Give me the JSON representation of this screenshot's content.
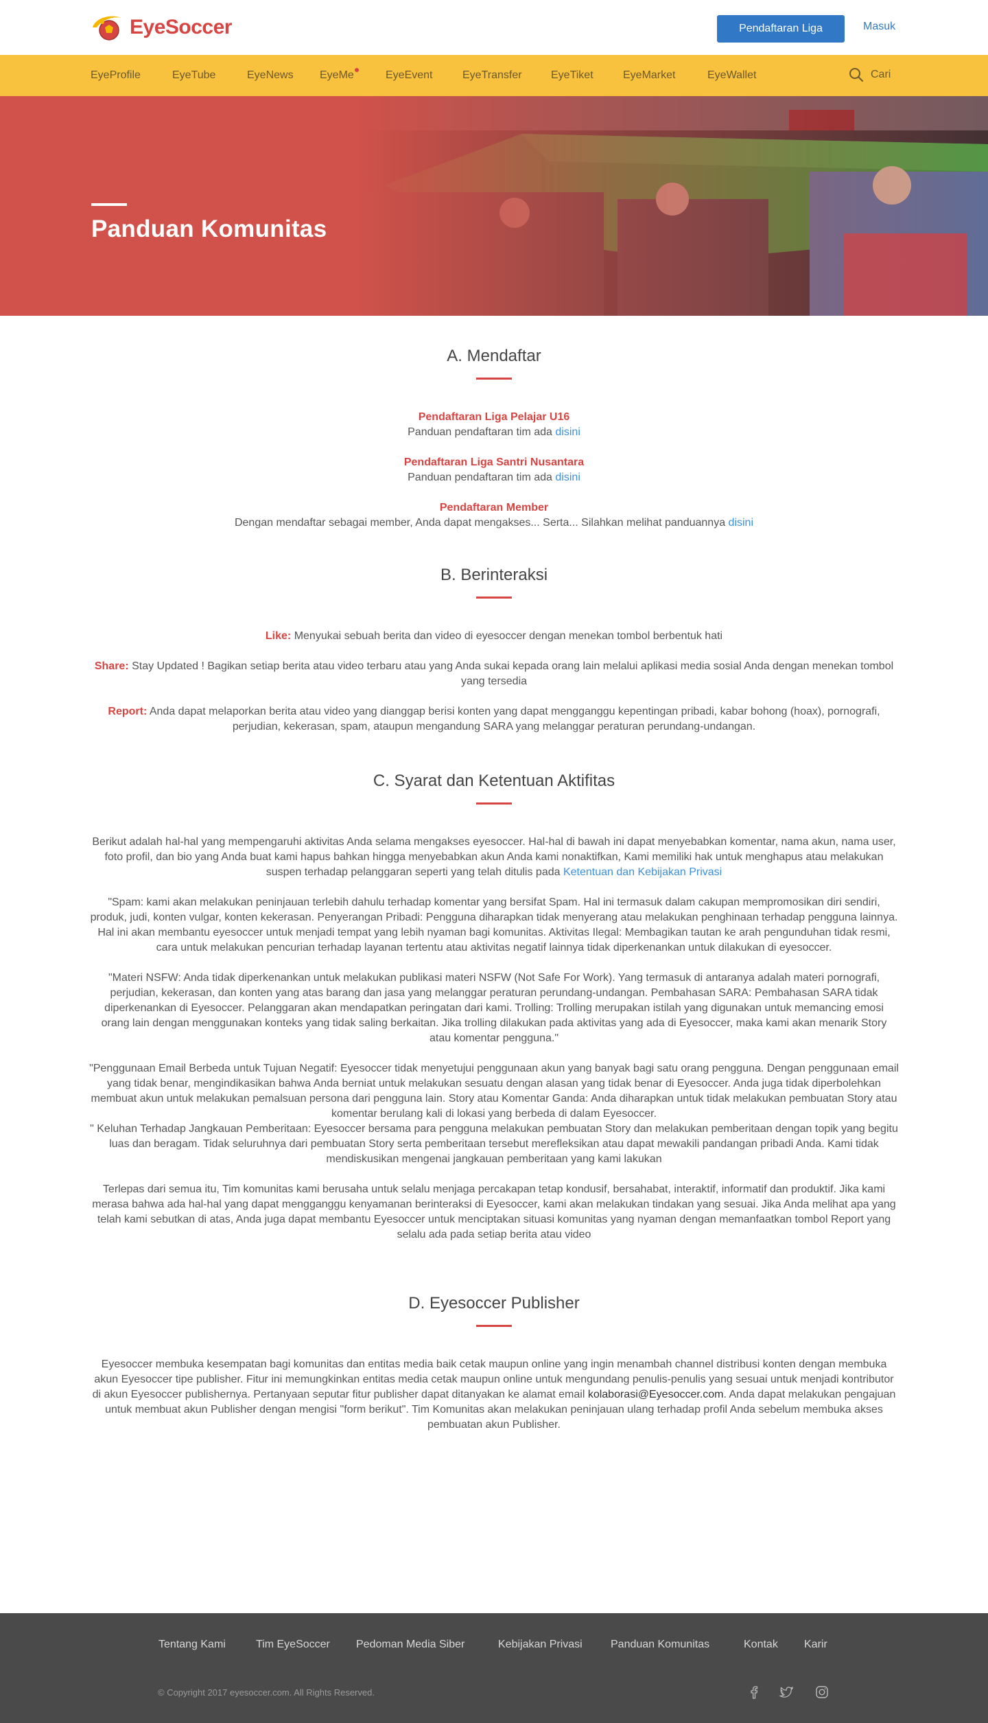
{
  "brand": {
    "name": "EyeSoccer",
    "logo_icon": "soccer-ball-logo-icon",
    "accent": "#d64541",
    "nav_color": "#f8c13e",
    "button_color": "#3179c6"
  },
  "header": {
    "register_label": "Pendaftaran Liga",
    "login_label": "Masuk"
  },
  "nav": {
    "items": [
      "EyeProfile",
      "EyeTube",
      "EyeNews",
      "EyeMe",
      "EyeEvent",
      "EyeTransfer",
      "EyeTiket",
      "EyeMarket",
      "EyeWallet"
    ],
    "search_label": "Cari",
    "search_icon": "search-icon"
  },
  "hero": {
    "title": "Panduan Komunitas"
  },
  "sec_a": {
    "title": "A. Mendaftar",
    "items": [
      {
        "heading": "Pendaftaran Liga Pelajar U16",
        "text": "Panduan pendaftaran tim ada",
        "link": "disini"
      },
      {
        "heading": "Pendaftaran Liga Santri Nusantara",
        "text": "Panduan pendaftaran tim ada",
        "link": "disini"
      },
      {
        "heading": "Pendaftaran Member",
        "text": "Dengan mendaftar sebagai member, Anda dapat mengakses... Serta... Silahkan melihat panduannya",
        "link": "disini"
      }
    ]
  },
  "sec_b": {
    "title": "B. Berinteraksi",
    "items": [
      {
        "label": "Like:",
        "text": "Menyukai sebuah berita dan video di eyesoccer dengan menekan tombol berbentuk hati"
      },
      {
        "label": "Share:",
        "text": "Stay Updated ! Bagikan setiap berita atau video terbaru atau yang Anda sukai kepada orang lain melalui aplikasi media sosial Anda dengan menekan tombol yang tersedia"
      },
      {
        "label": "Report:",
        "text": "Anda dapat melaporkan berita atau video yang dianggap berisi konten yang dapat mengganggu kepentingan pribadi, kabar bohong (hoax), pornografi, perjudian, kekerasan, spam, ataupun mengandung SARA yang melanggar peraturan perundang-undangan."
      }
    ]
  },
  "sec_c": {
    "title": "C. Syarat dan Ketentuan Aktifitas",
    "intro": "Berikut adalah hal-hal yang mempengaruhi aktivitas Anda selama mengakses eyesoccer. Hal-hal di bawah ini dapat menyebabkan komentar, nama akun, nama user, foto profil, dan bio yang Anda buat kami hapus bahkan hingga menyebabkan akun Anda kami nonaktifkan, Kami memiliki hak untuk menghapus atau melakukan suspen terhadap pelanggaran seperti yang telah ditulis pada",
    "intro_link": "Ketentuan dan Kebijakan Privasi",
    "p1": "\"Spam: kami akan melakukan peninjauan terlebih dahulu terhadap komentar yang bersifat Spam. Hal ini termasuk dalam cakupan mempromosikan diri sendiri, produk, judi, konten vulgar, konten kekerasan. Penyerangan Pribadi: Pengguna diharapkan tidak menyerang atau melakukan penghinaan terhadap pengguna lainnya. Hal ini akan membantu eyesoccer untuk menjadi tempat yang lebih nyaman bagi komunitas. Aktivitas Ilegal: Membagikan tautan ke arah pengunduhan tidak resmi, cara untuk melakukan pencurian terhadap layanan tertentu atau aktivitas negatif lainnya tidak diperkenankan untuk dilakukan di eyesoccer.",
    "p2": "\"Materi NSFW: Anda tidak diperkenankan untuk melakukan publikasi materi NSFW (Not Safe For Work). Yang termasuk di antaranya adalah materi pornografi, perjudian, kekerasan, dan konten yang atas barang dan jasa yang melanggar peraturan perundang-undangan. Pembahasan SARA: Pembahasan SARA tidak diperkenankan di Eyesoccer. Pelanggaran akan mendapatkan peringatan dari kami. Trolling: Trolling merupakan istilah yang digunakan untuk memancing emosi orang lain dengan menggunakan konteks yang tidak saling berkaitan. Jika trolling dilakukan pada aktivitas yang ada di Eyesoccer, maka kami akan menarik Story atau komentar pengguna.\"",
    "p3a": "\"Penggunaan Email Berbeda untuk Tujuan Negatif: Eyesoccer tidak menyetujui penggunaan akun yang banyak bagi satu orang pengguna. Dengan penggunaan email yang tidak benar, mengindikasikan bahwa Anda berniat untuk melakukan sesuatu dengan alasan yang tidak benar di Eyesoccer. Anda juga tidak diperbolehkan membuat akun untuk melakukan pemalsuan persona dari pengguna lain. Story atau Komentar Ganda: Anda diharapkan untuk tidak melakukan pembuatan Story atau komentar berulang kali di lokasi yang berbeda di dalam Eyesoccer.",
    "p3b": "\" Keluhan Terhadap Jangkauan Pemberitaan: Eyesoccer bersama para pengguna melakukan pembuatan Story dan melakukan pemberitaan dengan topik yang begitu luas dan beragam. Tidak seluruhnya dari pembuatan Story serta pemberitaan tersebut merefleksikan atau dapat mewakili pandangan pribadi Anda. Kami tidak mendiskusikan mengenai jangkauan pemberitaan yang kami lakukan",
    "p4": "Terlepas dari semua itu, Tim komunitas kami berusaha untuk selalu menjaga percakapan tetap kondusif, bersahabat, interaktif, informatif dan produktif. Jika kami merasa bahwa ada hal-hal yang dapat mengganggu kenyamanan berinteraksi di Eyesoccer, kami akan melakukan tindakan yang sesuai. Jika Anda melihat apa yang telah kami sebutkan di atas, Anda juga dapat membantu Eyesoccer untuk menciptakan situasi komunitas yang nyaman dengan memanfaatkan tombol Report yang selalu ada pada setiap berita atau video"
  },
  "sec_d": {
    "title": "D. Eyesoccer Publisher",
    "text_before": "Eyesoccer membuka kesempatan bagi komunitas dan entitas media baik cetak maupun online yang ingin menambah channel distribusi konten dengan membuka akun Eyesoccer tipe publisher. Fitur ini memungkinkan entitas media cetak maupun online untuk mengundang penulis-penulis yang sesuai untuk menjadi kontributor di akun Eyesoccer publishernya. Pertanyaan seputar fitur publisher dapat ditanyakan ke alamat email",
    "email": "kolaborasi@Eyesoccer.com",
    "text_after": ". Anda dapat melakukan pengajuan untuk membuat akun Publisher dengan mengisi \"form berikut\". Tim Komunitas akan melakukan peninjauan ulang terhadap profil Anda sebelum membuka akses pembuatan akun Publisher."
  },
  "footer": {
    "links": [
      "Tentang Kami",
      "Tim EyeSoccer",
      "Pedoman Media Siber",
      "Kebijakan Privasi",
      "Panduan Komunitas",
      "Kontak",
      "Karir"
    ],
    "copyright": "© Copyright 2017 eyesoccer.com. All Rights Reserved.",
    "social": [
      "facebook-icon",
      "twitter-icon",
      "instagram-icon"
    ]
  }
}
